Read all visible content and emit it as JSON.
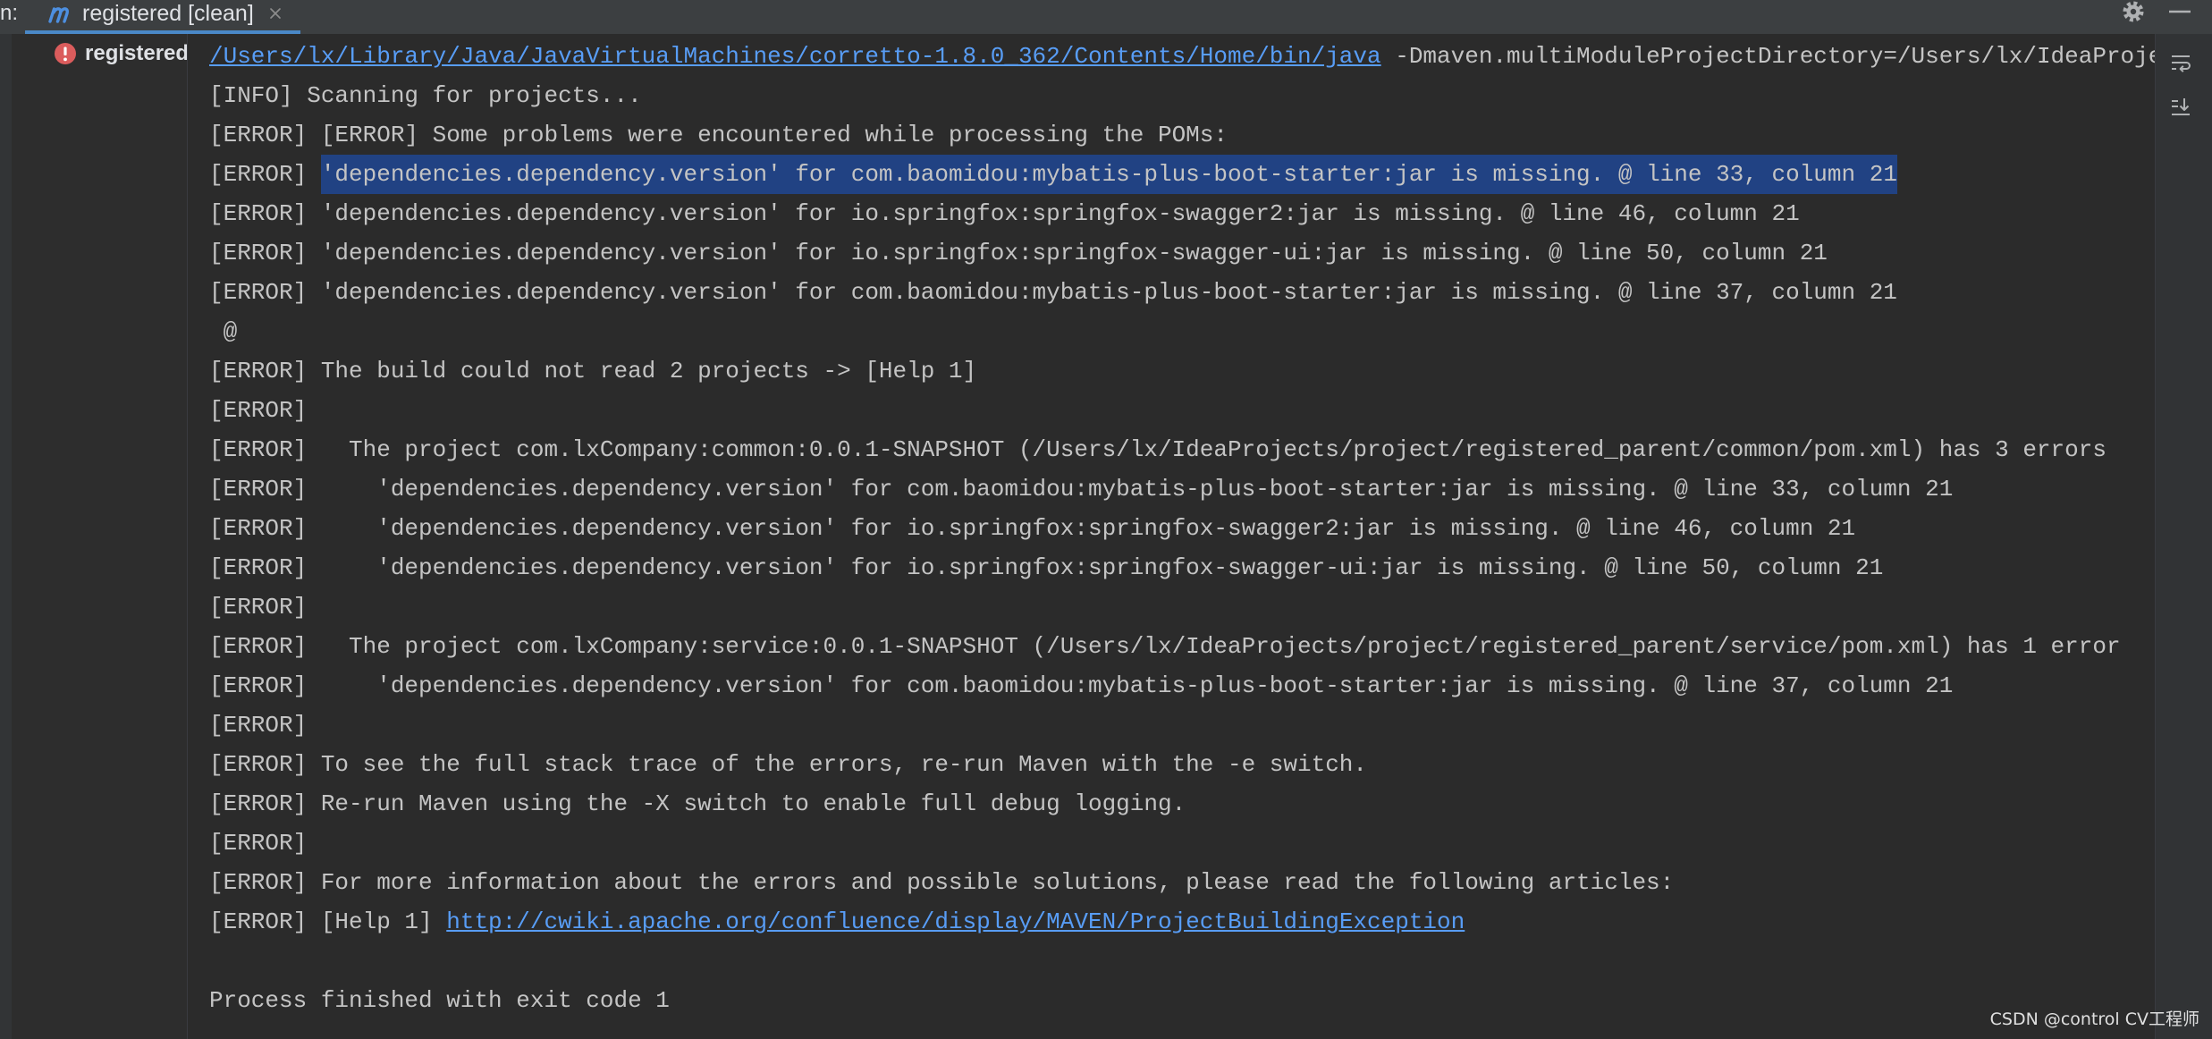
{
  "window": {
    "run_label": "n:",
    "tab_title": "registered [clean]"
  },
  "colors": {
    "accent": "#4a88c7",
    "link": "#589df6",
    "selection": "#214283",
    "error": "#db5c5c",
    "console_text": "#c4c4c4",
    "console_bg": "#2b2b2b"
  },
  "icons": {
    "tab": "maven-icon",
    "tab_close": "close-icon",
    "settings": "gear-icon",
    "minimize": "minimize-icon",
    "tree_status": "error-icon",
    "soft_wrap": "soft-wrap-icon",
    "scroll_to_end": "scroll-to-end-icon"
  },
  "tree": {
    "item_label": "registered"
  },
  "console": {
    "lines": [
      {
        "link": "/Users/lx/Library/Java/JavaVirtualMachines/corretto-1.8.0_362/Contents/Home/bin/java",
        "text": " -Dmaven.multiModuleProjectDirectory=/Users/lx/IdeaProje"
      },
      {
        "text": "[INFO] Scanning for projects..."
      },
      {
        "text": "[ERROR] [ERROR] Some problems were encountered while processing the POMs:"
      },
      {
        "prefix": "[ERROR] ",
        "selected": "'dependencies.dependency.version' for com.baomidou:mybatis-plus-boot-starter:jar is missing. @ line 33, column 21"
      },
      {
        "text": "[ERROR] 'dependencies.dependency.version' for io.springfox:springfox-swagger2:jar is missing. @ line 46, column 21"
      },
      {
        "text": "[ERROR] 'dependencies.dependency.version' for io.springfox:springfox-swagger-ui:jar is missing. @ line 50, column 21"
      },
      {
        "text": "[ERROR] 'dependencies.dependency.version' for com.baomidou:mybatis-plus-boot-starter:jar is missing. @ line 37, column 21"
      },
      {
        "text": " @"
      },
      {
        "text": "[ERROR] The build could not read 2 projects -> [Help 1]"
      },
      {
        "text": "[ERROR]"
      },
      {
        "text": "[ERROR]   The project com.lxCompany:common:0.0.1-SNAPSHOT (/Users/lx/IdeaProjects/project/registered_parent/common/pom.xml) has 3 errors"
      },
      {
        "text": "[ERROR]     'dependencies.dependency.version' for com.baomidou:mybatis-plus-boot-starter:jar is missing. @ line 33, column 21"
      },
      {
        "text": "[ERROR]     'dependencies.dependency.version' for io.springfox:springfox-swagger2:jar is missing. @ line 46, column 21"
      },
      {
        "text": "[ERROR]     'dependencies.dependency.version' for io.springfox:springfox-swagger-ui:jar is missing. @ line 50, column 21"
      },
      {
        "text": "[ERROR]"
      },
      {
        "text": "[ERROR]   The project com.lxCompany:service:0.0.1-SNAPSHOT (/Users/lx/IdeaProjects/project/registered_parent/service/pom.xml) has 1 error"
      },
      {
        "text": "[ERROR]     'dependencies.dependency.version' for com.baomidou:mybatis-plus-boot-starter:jar is missing. @ line 37, column 21"
      },
      {
        "text": "[ERROR]"
      },
      {
        "text": "[ERROR] To see the full stack trace of the errors, re-run Maven with the -e switch."
      },
      {
        "text": "[ERROR] Re-run Maven using the -X switch to enable full debug logging."
      },
      {
        "text": "[ERROR]"
      },
      {
        "text": "[ERROR] For more information about the errors and possible solutions, please read the following articles:"
      },
      {
        "prefix": "[ERROR] [Help 1] ",
        "link": "http://cwiki.apache.org/confluence/display/MAVEN/ProjectBuildingException"
      },
      {
        "text": ""
      },
      {
        "text": "Process finished with exit code 1"
      }
    ]
  },
  "watermark": "CSDN @control CV工程师"
}
